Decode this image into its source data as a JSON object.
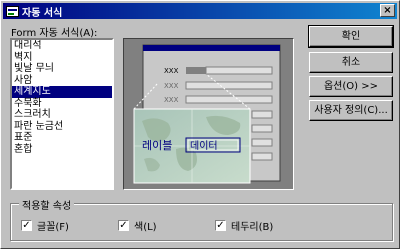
{
  "window": {
    "title": "자동 서식",
    "close_label": "×"
  },
  "list": {
    "label": "Form 자동 서식(A):",
    "items": [
      "대리석",
      "벽지",
      "빛날 무늬",
      "사암",
      "세계지도",
      "수묵화",
      "스크러치",
      "파란 눈금선",
      "표준",
      "혼합"
    ],
    "selected_index": 4
  },
  "preview": {
    "placeholder": "XXX",
    "label_text": "레이블",
    "data_text": "데이터"
  },
  "buttons": {
    "ok": "확인",
    "cancel": "취소",
    "options": "옵션(O) >>",
    "customize": "사용자 정의(C)..."
  },
  "attributes": {
    "title": "적용할 속성",
    "font": "글꼴(F)",
    "color": "색(L)",
    "border": "테두리(B)"
  },
  "colors": {
    "title_start": "#000080",
    "title_end": "#1084d0",
    "selection": "#000080"
  }
}
